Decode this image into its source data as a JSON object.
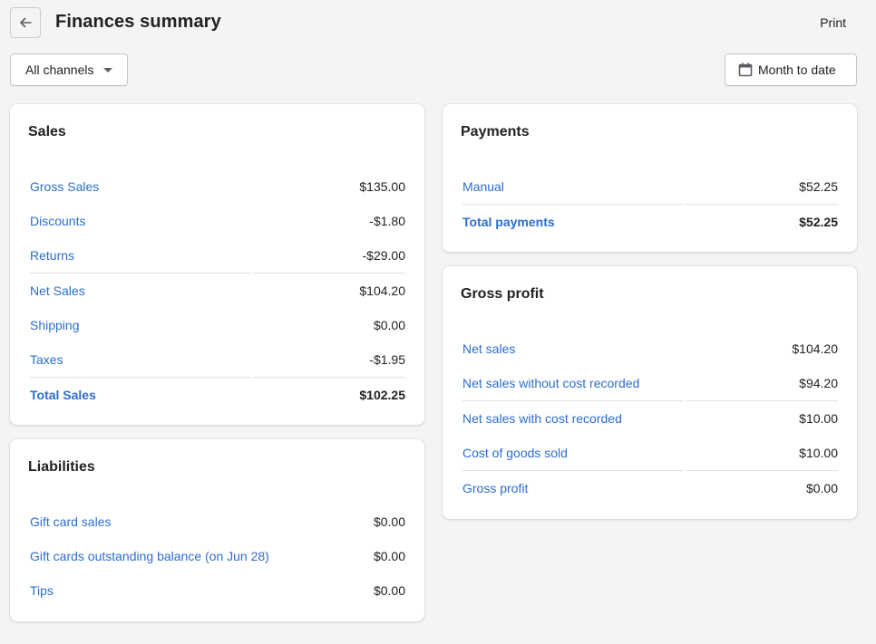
{
  "header": {
    "title": "Finances summary",
    "back_icon": "arrow-left-icon",
    "print_label": "Print"
  },
  "filters": {
    "channel": {
      "selected": "All channels",
      "icon": "caret-down-icon"
    },
    "date_range": {
      "label": "Month to date",
      "icon": "calendar-icon"
    }
  },
  "colors": {
    "link": "#2c6ecb",
    "text": "#202223",
    "background": "#f4f4f4",
    "card": "#ffffff",
    "divider": "#e1e3e5"
  },
  "sales": {
    "title": "Sales",
    "rows": [
      {
        "label": "Gross Sales",
        "value": "$135.00"
      },
      {
        "label": "Discounts",
        "value": "-$1.80"
      },
      {
        "label": "Returns",
        "value": "-$29.00"
      },
      {
        "label": "Net Sales",
        "value": "$104.20"
      },
      {
        "label": "Shipping",
        "value": "$0.00"
      },
      {
        "label": "Taxes",
        "value": "-$1.95"
      },
      {
        "label": "Total Sales",
        "value": "$102.25"
      }
    ]
  },
  "liabilities": {
    "title": "Liabilities",
    "rows": [
      {
        "label": "Gift card sales",
        "value": "$0.00"
      },
      {
        "label": "Gift cards outstanding balance (on Jun 28)",
        "value": "$0.00"
      },
      {
        "label": "Tips",
        "value": "$0.00"
      }
    ]
  },
  "payments": {
    "title": "Payments",
    "rows": [
      {
        "label": "Manual",
        "value": "$52.25"
      },
      {
        "label": "Total payments",
        "value": "$52.25"
      }
    ]
  },
  "gross_profit": {
    "title": "Gross profit",
    "rows": [
      {
        "label": "Net sales",
        "value": "$104.20"
      },
      {
        "label": "Net sales without cost recorded",
        "value": "$94.20"
      },
      {
        "label": "Net sales with cost recorded",
        "value": "$10.00"
      },
      {
        "label": "Cost of goods sold",
        "value": "$10.00"
      },
      {
        "label": "Gross profit",
        "value": "$0.00"
      }
    ]
  }
}
